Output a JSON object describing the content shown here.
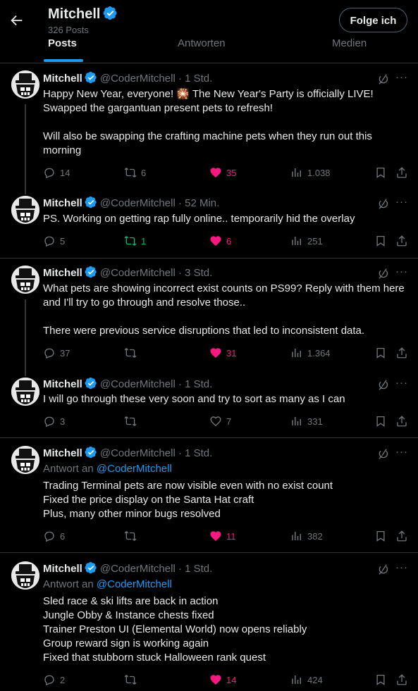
{
  "header": {
    "name": "Mitchell",
    "post_count": "326 Posts",
    "follow_label": "Folge ich",
    "tabs": [
      {
        "label": "Posts",
        "active": true
      },
      {
        "label": "Antworten",
        "active": false
      },
      {
        "label": "Medien",
        "active": false
      }
    ]
  },
  "colors": {
    "accent": "#1d9bf0",
    "like": "#f91880",
    "repost": "#00ba7c",
    "muted": "#71767b"
  },
  "posts": [
    {
      "name": "Mitchell",
      "handle": "@CoderMitchell · 1 Std.",
      "text": "Happy New Year, everyone! 🎇 The New Year's Party is officially LIVE! Swapped the gargantuan present pets to refresh!\n\nWill also be swapping the crafting machine pets when they run out this morning",
      "replies": "14",
      "reposts": "6",
      "likes": "35",
      "views": "1.038"
    },
    {
      "name": "Mitchell",
      "handle": "@CoderMitchell · 52 Min.",
      "text": "PS. Working on getting rap fully online.. temporarily hid the overlay",
      "replies": "5",
      "reposts": "1",
      "likes": "6",
      "views": "251"
    },
    {
      "name": "Mitchell",
      "handle": "@CoderMitchell · 3 Std.",
      "text": "What pets are showing incorrect exist counts on PS99? Reply with them here and I'll try to go through and resolve those..\n\nThere were previous service disruptions that led to inconsistent data.",
      "replies": "37",
      "reposts": "",
      "likes": "31",
      "views": "1.364"
    },
    {
      "name": "Mitchell",
      "handle": "@CoderMitchell · 1 Std.",
      "text": "I will go through these very soon and try to sort as many as I can",
      "replies": "3",
      "reposts": "",
      "likes": "7",
      "views": "331"
    },
    {
      "name": "Mitchell",
      "handle": "@CoderMitchell · 1 Std.",
      "reply_prefix": "Antwort an",
      "reply_to": "@CoderMitchell",
      "text": "Trading Terminal pets are now visible even with no exist count\nFixed the price display on the Santa Hat craft\nPlus, many other minor bugs resolved",
      "replies": "6",
      "reposts": "",
      "likes": "11",
      "views": "382"
    },
    {
      "name": "Mitchell",
      "handle": "@CoderMitchell · 1 Std.",
      "reply_prefix": "Antwort an",
      "reply_to": "@CoderMitchell",
      "text": "Sled race & ski lifts are back in action\nJungle Obby & Instance chests fixed\nTrainer Preston UI (Elemental World) now opens reliably\nGroup reward sign is working again\nFixed that stubborn stuck Halloween rank quest",
      "replies": "2",
      "reposts": "",
      "likes": "14",
      "views": "424"
    }
  ]
}
